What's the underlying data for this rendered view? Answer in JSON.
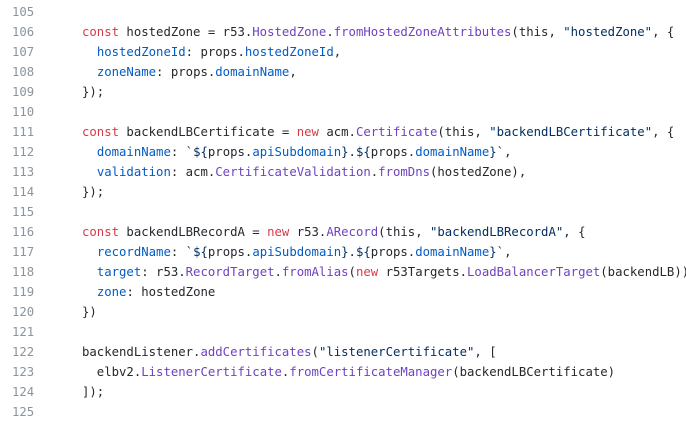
{
  "editor": {
    "language": "typescript",
    "colors": {
      "keyword": "#d73a49",
      "plain": "#24292e",
      "entity": "#6f42c1",
      "property": "#005cc5",
      "string": "#032f62",
      "line_number": "#8b949e",
      "background": "#ffffff"
    },
    "lines": [
      {
        "number": "105",
        "tokens": []
      },
      {
        "number": "106",
        "tokens": [
          {
            "t": "keyword",
            "v": "const "
          },
          {
            "t": "plain",
            "v": "hostedZone = r53."
          },
          {
            "t": "entity",
            "v": "HostedZone"
          },
          {
            "t": "plain",
            "v": "."
          },
          {
            "t": "entity",
            "v": "fromHostedZoneAttributes"
          },
          {
            "t": "plain",
            "v": "(this, "
          },
          {
            "t": "string",
            "v": "\"hostedZone\""
          },
          {
            "t": "plain",
            "v": ", {"
          }
        ]
      },
      {
        "number": "107",
        "tokens": [
          {
            "t": "plain",
            "v": "  "
          },
          {
            "t": "prop",
            "v": "hostedZoneId"
          },
          {
            "t": "plain",
            "v": ": props."
          },
          {
            "t": "prop",
            "v": "hostedZoneId"
          },
          {
            "t": "plain",
            "v": ","
          }
        ]
      },
      {
        "number": "108",
        "tokens": [
          {
            "t": "plain",
            "v": "  "
          },
          {
            "t": "prop",
            "v": "zoneName"
          },
          {
            "t": "plain",
            "v": ": props."
          },
          {
            "t": "prop",
            "v": "domainName"
          },
          {
            "t": "plain",
            "v": ","
          }
        ]
      },
      {
        "number": "109",
        "tokens": [
          {
            "t": "plain",
            "v": "});"
          }
        ]
      },
      {
        "number": "110",
        "tokens": []
      },
      {
        "number": "111",
        "tokens": [
          {
            "t": "keyword",
            "v": "const "
          },
          {
            "t": "plain",
            "v": "backendLBCertificate = "
          },
          {
            "t": "keyword",
            "v": "new "
          },
          {
            "t": "plain",
            "v": "acm."
          },
          {
            "t": "entity",
            "v": "Certificate"
          },
          {
            "t": "plain",
            "v": "(this, "
          },
          {
            "t": "string",
            "v": "\"backendLBCertificate\""
          },
          {
            "t": "plain",
            "v": ", {"
          }
        ]
      },
      {
        "number": "112",
        "tokens": [
          {
            "t": "plain",
            "v": "  "
          },
          {
            "t": "prop",
            "v": "domainName"
          },
          {
            "t": "plain",
            "v": ": "
          },
          {
            "t": "string",
            "v": "`${"
          },
          {
            "t": "plain",
            "v": "props."
          },
          {
            "t": "prop",
            "v": "apiSubdomain"
          },
          {
            "t": "string",
            "v": "}.${"
          },
          {
            "t": "plain",
            "v": "props."
          },
          {
            "t": "prop",
            "v": "domainName"
          },
          {
            "t": "string",
            "v": "}`"
          },
          {
            "t": "plain",
            "v": ","
          }
        ]
      },
      {
        "number": "113",
        "tokens": [
          {
            "t": "plain",
            "v": "  "
          },
          {
            "t": "prop",
            "v": "validation"
          },
          {
            "t": "plain",
            "v": ": acm."
          },
          {
            "t": "entity",
            "v": "CertificateValidation"
          },
          {
            "t": "plain",
            "v": "."
          },
          {
            "t": "entity",
            "v": "fromDns"
          },
          {
            "t": "plain",
            "v": "(hostedZone),"
          }
        ]
      },
      {
        "number": "114",
        "tokens": [
          {
            "t": "plain",
            "v": "});"
          }
        ]
      },
      {
        "number": "115",
        "tokens": []
      },
      {
        "number": "116",
        "tokens": [
          {
            "t": "keyword",
            "v": "const "
          },
          {
            "t": "plain",
            "v": "backendLBRecordA = "
          },
          {
            "t": "keyword",
            "v": "new "
          },
          {
            "t": "plain",
            "v": "r53."
          },
          {
            "t": "entity",
            "v": "ARecord"
          },
          {
            "t": "plain",
            "v": "(this, "
          },
          {
            "t": "string",
            "v": "\"backendLBRecordA\""
          },
          {
            "t": "plain",
            "v": ", {"
          }
        ]
      },
      {
        "number": "117",
        "tokens": [
          {
            "t": "plain",
            "v": "  "
          },
          {
            "t": "prop",
            "v": "recordName"
          },
          {
            "t": "plain",
            "v": ": "
          },
          {
            "t": "string",
            "v": "`${"
          },
          {
            "t": "plain",
            "v": "props."
          },
          {
            "t": "prop",
            "v": "apiSubdomain"
          },
          {
            "t": "string",
            "v": "}.${"
          },
          {
            "t": "plain",
            "v": "props."
          },
          {
            "t": "prop",
            "v": "domainName"
          },
          {
            "t": "string",
            "v": "}`"
          },
          {
            "t": "plain",
            "v": ","
          }
        ]
      },
      {
        "number": "118",
        "tokens": [
          {
            "t": "plain",
            "v": "  "
          },
          {
            "t": "prop",
            "v": "target"
          },
          {
            "t": "plain",
            "v": ": r53."
          },
          {
            "t": "entity",
            "v": "RecordTarget"
          },
          {
            "t": "plain",
            "v": "."
          },
          {
            "t": "entity",
            "v": "fromAlias"
          },
          {
            "t": "plain",
            "v": "("
          },
          {
            "t": "keyword",
            "v": "new "
          },
          {
            "t": "plain",
            "v": "r53Targets."
          },
          {
            "t": "entity",
            "v": "LoadBalancerTarget"
          },
          {
            "t": "plain",
            "v": "(backendLB)),"
          }
        ]
      },
      {
        "number": "119",
        "tokens": [
          {
            "t": "plain",
            "v": "  "
          },
          {
            "t": "prop",
            "v": "zone"
          },
          {
            "t": "plain",
            "v": ": hostedZone"
          }
        ]
      },
      {
        "number": "120",
        "tokens": [
          {
            "t": "plain",
            "v": "})"
          }
        ]
      },
      {
        "number": "121",
        "tokens": []
      },
      {
        "number": "122",
        "tokens": [
          {
            "t": "plain",
            "v": "backendListener."
          },
          {
            "t": "entity",
            "v": "addCertificates"
          },
          {
            "t": "plain",
            "v": "("
          },
          {
            "t": "string",
            "v": "\"listenerCertificate\""
          },
          {
            "t": "plain",
            "v": ", ["
          }
        ]
      },
      {
        "number": "123",
        "tokens": [
          {
            "t": "plain",
            "v": "  elbv2."
          },
          {
            "t": "entity",
            "v": "ListenerCertificate"
          },
          {
            "t": "plain",
            "v": "."
          },
          {
            "t": "entity",
            "v": "fromCertificateManager"
          },
          {
            "t": "plain",
            "v": "(backendLBCertificate)"
          }
        ]
      },
      {
        "number": "124",
        "tokens": [
          {
            "t": "plain",
            "v": "]);"
          }
        ]
      },
      {
        "number": "125",
        "tokens": []
      }
    ]
  }
}
